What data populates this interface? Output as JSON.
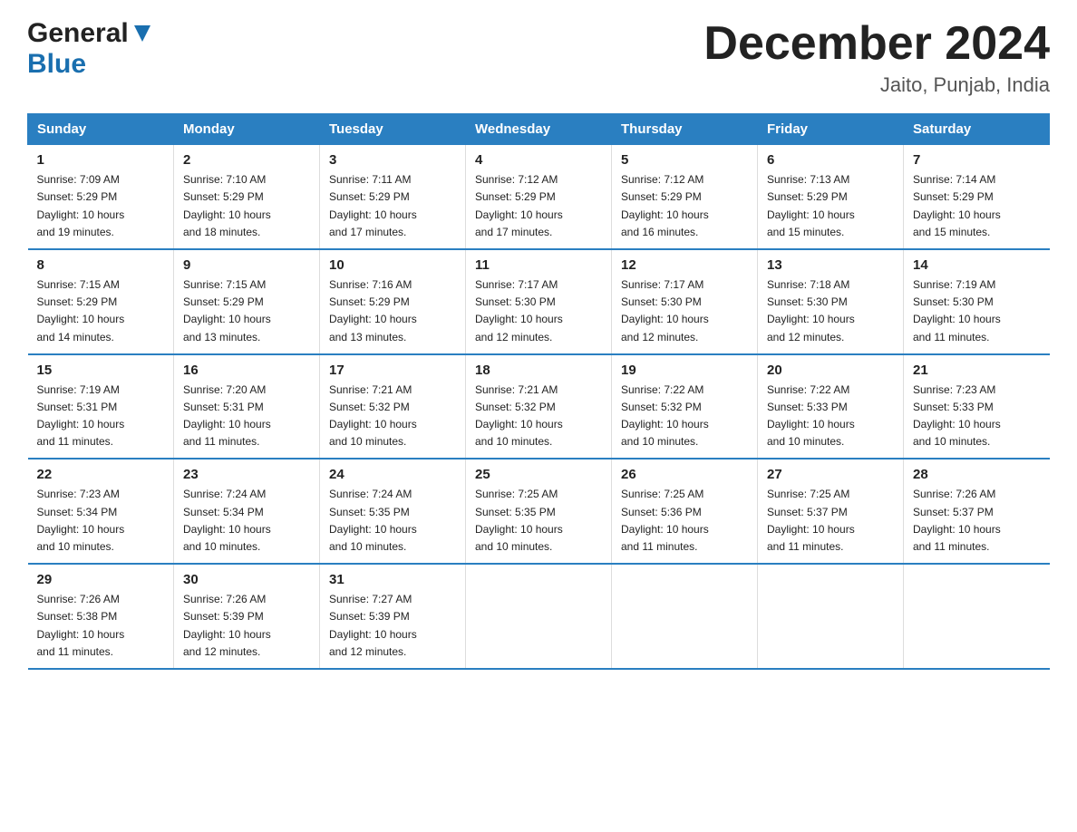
{
  "logo": {
    "general": "General",
    "blue": "Blue"
  },
  "title": "December 2024",
  "location": "Jaito, Punjab, India",
  "days_of_week": [
    "Sunday",
    "Monday",
    "Tuesday",
    "Wednesday",
    "Thursday",
    "Friday",
    "Saturday"
  ],
  "weeks": [
    [
      {
        "day": "1",
        "sunrise": "7:09 AM",
        "sunset": "5:29 PM",
        "daylight": "10 hours and 19 minutes."
      },
      {
        "day": "2",
        "sunrise": "7:10 AM",
        "sunset": "5:29 PM",
        "daylight": "10 hours and 18 minutes."
      },
      {
        "day": "3",
        "sunrise": "7:11 AM",
        "sunset": "5:29 PM",
        "daylight": "10 hours and 17 minutes."
      },
      {
        "day": "4",
        "sunrise": "7:12 AM",
        "sunset": "5:29 PM",
        "daylight": "10 hours and 17 minutes."
      },
      {
        "day": "5",
        "sunrise": "7:12 AM",
        "sunset": "5:29 PM",
        "daylight": "10 hours and 16 minutes."
      },
      {
        "day": "6",
        "sunrise": "7:13 AM",
        "sunset": "5:29 PM",
        "daylight": "10 hours and 15 minutes."
      },
      {
        "day": "7",
        "sunrise": "7:14 AM",
        "sunset": "5:29 PM",
        "daylight": "10 hours and 15 minutes."
      }
    ],
    [
      {
        "day": "8",
        "sunrise": "7:15 AM",
        "sunset": "5:29 PM",
        "daylight": "10 hours and 14 minutes."
      },
      {
        "day": "9",
        "sunrise": "7:15 AM",
        "sunset": "5:29 PM",
        "daylight": "10 hours and 13 minutes."
      },
      {
        "day": "10",
        "sunrise": "7:16 AM",
        "sunset": "5:29 PM",
        "daylight": "10 hours and 13 minutes."
      },
      {
        "day": "11",
        "sunrise": "7:17 AM",
        "sunset": "5:30 PM",
        "daylight": "10 hours and 12 minutes."
      },
      {
        "day": "12",
        "sunrise": "7:17 AM",
        "sunset": "5:30 PM",
        "daylight": "10 hours and 12 minutes."
      },
      {
        "day": "13",
        "sunrise": "7:18 AM",
        "sunset": "5:30 PM",
        "daylight": "10 hours and 12 minutes."
      },
      {
        "day": "14",
        "sunrise": "7:19 AM",
        "sunset": "5:30 PM",
        "daylight": "10 hours and 11 minutes."
      }
    ],
    [
      {
        "day": "15",
        "sunrise": "7:19 AM",
        "sunset": "5:31 PM",
        "daylight": "10 hours and 11 minutes."
      },
      {
        "day": "16",
        "sunrise": "7:20 AM",
        "sunset": "5:31 PM",
        "daylight": "10 hours and 11 minutes."
      },
      {
        "day": "17",
        "sunrise": "7:21 AM",
        "sunset": "5:32 PM",
        "daylight": "10 hours and 10 minutes."
      },
      {
        "day": "18",
        "sunrise": "7:21 AM",
        "sunset": "5:32 PM",
        "daylight": "10 hours and 10 minutes."
      },
      {
        "day": "19",
        "sunrise": "7:22 AM",
        "sunset": "5:32 PM",
        "daylight": "10 hours and 10 minutes."
      },
      {
        "day": "20",
        "sunrise": "7:22 AM",
        "sunset": "5:33 PM",
        "daylight": "10 hours and 10 minutes."
      },
      {
        "day": "21",
        "sunrise": "7:23 AM",
        "sunset": "5:33 PM",
        "daylight": "10 hours and 10 minutes."
      }
    ],
    [
      {
        "day": "22",
        "sunrise": "7:23 AM",
        "sunset": "5:34 PM",
        "daylight": "10 hours and 10 minutes."
      },
      {
        "day": "23",
        "sunrise": "7:24 AM",
        "sunset": "5:34 PM",
        "daylight": "10 hours and 10 minutes."
      },
      {
        "day": "24",
        "sunrise": "7:24 AM",
        "sunset": "5:35 PM",
        "daylight": "10 hours and 10 minutes."
      },
      {
        "day": "25",
        "sunrise": "7:25 AM",
        "sunset": "5:35 PM",
        "daylight": "10 hours and 10 minutes."
      },
      {
        "day": "26",
        "sunrise": "7:25 AM",
        "sunset": "5:36 PM",
        "daylight": "10 hours and 11 minutes."
      },
      {
        "day": "27",
        "sunrise": "7:25 AM",
        "sunset": "5:37 PM",
        "daylight": "10 hours and 11 minutes."
      },
      {
        "day": "28",
        "sunrise": "7:26 AM",
        "sunset": "5:37 PM",
        "daylight": "10 hours and 11 minutes."
      }
    ],
    [
      {
        "day": "29",
        "sunrise": "7:26 AM",
        "sunset": "5:38 PM",
        "daylight": "10 hours and 11 minutes."
      },
      {
        "day": "30",
        "sunrise": "7:26 AM",
        "sunset": "5:39 PM",
        "daylight": "10 hours and 12 minutes."
      },
      {
        "day": "31",
        "sunrise": "7:27 AM",
        "sunset": "5:39 PM",
        "daylight": "10 hours and 12 minutes."
      },
      null,
      null,
      null,
      null
    ]
  ],
  "cell_labels": {
    "sunrise": "Sunrise:",
    "sunset": "Sunset:",
    "daylight": "Daylight:"
  }
}
